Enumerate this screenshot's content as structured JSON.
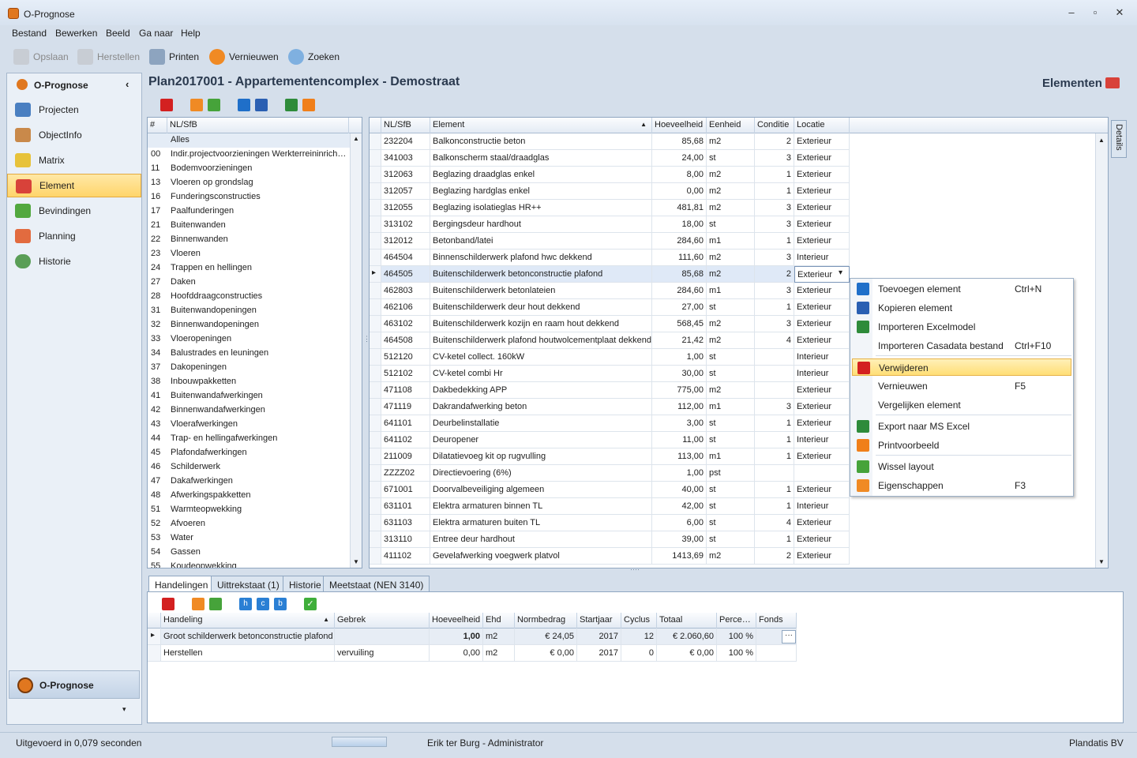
{
  "window": {
    "title": "O-Prognose"
  },
  "menu": [
    "Bestand",
    "Bewerken",
    "Beeld",
    "Ga naar",
    "Help"
  ],
  "toolbar": {
    "save": "Opslaan",
    "restore": "Herstellen",
    "print": "Printen",
    "refresh": "Vernieuwen",
    "search": "Zoeken"
  },
  "nav": {
    "header": "O-Prognose",
    "items": [
      "Projecten",
      "ObjectInfo",
      "Matrix",
      "Element",
      "Bevindingen",
      "Planning",
      "Historie"
    ],
    "selected": "Element",
    "bottom": "O-Prognose"
  },
  "header": {
    "title": "Plan2017001 - Appartementencomplex - Demostraat",
    "section": "Elementen"
  },
  "categories": {
    "headers": [
      "#",
      "NL/SfB"
    ],
    "rows": [
      [
        "",
        "Alles"
      ],
      [
        "00",
        "Indir.projectvoorzieningen Werkterreininrich…"
      ],
      [
        "11",
        "Bodemvoorzieningen"
      ],
      [
        "13",
        "Vloeren op grondslag"
      ],
      [
        "16",
        "Funderingsconstructies"
      ],
      [
        "17",
        "Paalfunderingen"
      ],
      [
        "21",
        "Buitenwanden"
      ],
      [
        "22",
        "Binnenwanden"
      ],
      [
        "23",
        "Vloeren"
      ],
      [
        "24",
        "Trappen en hellingen"
      ],
      [
        "27",
        "Daken"
      ],
      [
        "28",
        "Hoofddraagconstructies"
      ],
      [
        "31",
        "Buitenwandopeningen"
      ],
      [
        "32",
        "Binnenwandopeningen"
      ],
      [
        "33",
        "Vloeropeningen"
      ],
      [
        "34",
        "Balustrades en leuningen"
      ],
      [
        "37",
        "Dakopeningen"
      ],
      [
        "38",
        "Inbouwpakketten"
      ],
      [
        "41",
        "Buitenwandafwerkingen"
      ],
      [
        "42",
        "Binnenwandafwerkingen"
      ],
      [
        "43",
        "Vloerafwerkingen"
      ],
      [
        "44",
        "Trap- en hellingafwerkingen"
      ],
      [
        "45",
        "Plafondafwerkingen"
      ],
      [
        "46",
        "Schilderwerk"
      ],
      [
        "47",
        "Dakafwerkingen"
      ],
      [
        "48",
        "Afwerkingspakketten"
      ],
      [
        "51",
        "Warmteopwekking"
      ],
      [
        "52",
        "Afvoeren"
      ],
      [
        "53",
        "Water"
      ],
      [
        "54",
        "Gassen"
      ],
      [
        "55",
        "Koudeopwekking"
      ]
    ]
  },
  "elements": {
    "headers": [
      "NL/SfB",
      "Element",
      "Hoeveelheid",
      "Eenheid",
      "Conditie",
      "Locatie"
    ],
    "rows": [
      [
        "232204",
        "Balkonconstructie beton",
        "85,68",
        "m2",
        "2",
        "Exterieur"
      ],
      [
        "341003",
        "Balkonscherm staal/draadglas",
        "24,00",
        "st",
        "3",
        "Exterieur"
      ],
      [
        "312063",
        "Beglazing draadglas enkel",
        "8,00",
        "m2",
        "1",
        "Exterieur"
      ],
      [
        "312057",
        "Beglazing hardglas enkel",
        "0,00",
        "m2",
        "1",
        "Exterieur"
      ],
      [
        "312055",
        "Beglazing isolatieglas HR++",
        "481,81",
        "m2",
        "3",
        "Exterieur"
      ],
      [
        "313102",
        "Bergingsdeur hardhout",
        "18,00",
        "st",
        "3",
        "Exterieur"
      ],
      [
        "312012",
        "Betonband/latei",
        "284,60",
        "m1",
        "1",
        "Exterieur"
      ],
      [
        "464504",
        "Binnenschilderwerk plafond hwc dekkend",
        "111,60",
        "m2",
        "3",
        "Interieur"
      ],
      [
        "464505",
        "Buitenschilderwerk betonconstructie plafond",
        "85,68",
        "m2",
        "2",
        "Exterieur"
      ],
      [
        "462803",
        "Buitenschilderwerk betonlateien",
        "284,60",
        "m1",
        "3",
        "Exterieur"
      ],
      [
        "462106",
        "Buitenschilderwerk deur hout dekkend",
        "27,00",
        "st",
        "1",
        "Exterieur"
      ],
      [
        "463102",
        "Buitenschilderwerk kozijn en raam hout dekkend",
        "568,45",
        "m2",
        "3",
        "Exterieur"
      ],
      [
        "464508",
        "Buitenschilderwerk plafond houtwolcementplaat dekkend",
        "21,42",
        "m2",
        "4",
        "Exterieur"
      ],
      [
        "512120",
        "CV-ketel collect. 160kW",
        "1,00",
        "st",
        "",
        "Interieur"
      ],
      [
        "512102",
        "CV-ketel combi Hr",
        "30,00",
        "st",
        "",
        "Interieur"
      ],
      [
        "471108",
        "Dakbedekking APP",
        "775,00",
        "m2",
        "",
        "Exterieur"
      ],
      [
        "471119",
        "Dakrandafwerking beton",
        "112,00",
        "m1",
        "3",
        "Exterieur"
      ],
      [
        "641101",
        "Deurbelinstallatie",
        "3,00",
        "st",
        "1",
        "Exterieur"
      ],
      [
        "641102",
        "Deuropener",
        "11,00",
        "st",
        "1",
        "Interieur"
      ],
      [
        "211009",
        "Dilatatievoeg kit op rugvulling",
        "113,00",
        "m1",
        "1",
        "Exterieur"
      ],
      [
        "ZZZZ02",
        "Directievoering (6%)",
        "1,00",
        "pst",
        "",
        ""
      ],
      [
        "671001",
        "Doorvalbeveiliging algemeen",
        "40,00",
        "st",
        "1",
        "Exterieur"
      ],
      [
        "631101",
        "Elektra armaturen binnen TL",
        "42,00",
        "st",
        "1",
        "Interieur"
      ],
      [
        "631103",
        "Elektra armaturen buiten TL",
        "6,00",
        "st",
        "4",
        "Exterieur"
      ],
      [
        "313110",
        "Entree deur hardhout",
        "39,00",
        "st",
        "1",
        "Exterieur"
      ],
      [
        "411102",
        "Gevelafwerking voegwerk platvol",
        "1413,69",
        "m2",
        "2",
        "Exterieur"
      ]
    ]
  },
  "context_menu": [
    {
      "label": "Toevoegen element",
      "shortcut": "Ctrl+N",
      "icon": "add-icon"
    },
    {
      "label": "Kopieren element",
      "shortcut": "",
      "icon": "copy-icon"
    },
    {
      "label": "Importeren Excelmodel",
      "shortcut": "",
      "icon": "excel-icon"
    },
    {
      "label": "Importeren Casadata bestand",
      "shortcut": "Ctrl+F10",
      "icon": ""
    },
    {
      "label": "Verwijderen",
      "shortcut": "",
      "icon": "delete-icon"
    },
    {
      "label": "Vernieuwen",
      "shortcut": "F5",
      "icon": ""
    },
    {
      "label": "Vergelijken element",
      "shortcut": "",
      "icon": ""
    },
    {
      "label": "Export naar MS Excel",
      "shortcut": "",
      "icon": "excel-icon"
    },
    {
      "label": "Printvoorbeeld",
      "shortcut": "",
      "icon": "print-icon"
    },
    {
      "label": "Wissel layout",
      "shortcut": "",
      "icon": "layout-icon"
    },
    {
      "label": "Eigenschappen",
      "shortcut": "F3",
      "icon": "properties-icon"
    }
  ],
  "details_tab": "Details",
  "bottom_tabs": [
    "Handelingen",
    "Uittrekstaat (1)",
    "Historie",
    "Meetstaat (NEN 3140)"
  ],
  "actions": {
    "headers": [
      "Handeling",
      "Gebrek",
      "Hoeveelheid",
      "Ehd",
      "Normbedrag",
      "Startjaar",
      "Cyclus",
      "Totaal",
      "Perce…",
      "Fonds"
    ],
    "rows": [
      [
        "Groot schilderwerk betonconstructie plafond",
        "",
        "1,00",
        "m2",
        "€ 24,05",
        "2017",
        "12",
        "€ 2.060,60",
        "100 %",
        ""
      ],
      [
        "Herstellen",
        "vervuiling",
        "0,00",
        "m2",
        "€ 0,00",
        "2017",
        "0",
        "€ 0,00",
        "100 %",
        ""
      ]
    ]
  },
  "status": {
    "left": "Uitgevoerd in 0,079 seconden",
    "user": "Erik ter Burg - Administrator",
    "company": "Plandatis BV"
  },
  "colors": {
    "accent": "#ffd56b",
    "delete": "#d32020",
    "excel": "#2e8b3a",
    "add": "#1f6fc9",
    "orange": "#f07f1a"
  }
}
